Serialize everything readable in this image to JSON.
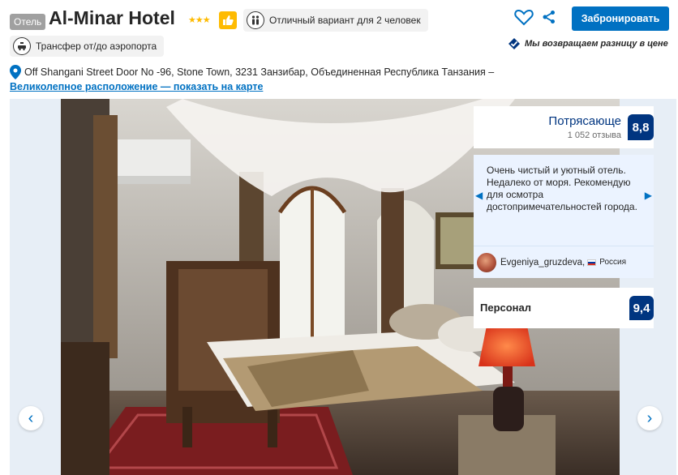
{
  "header": {
    "type_badge": "Отель",
    "hotel_name": "Al-Minar Hotel",
    "stars": "★★★",
    "star_rating": 3,
    "couple_label": "Отличный вариант для 2 человек",
    "transfer_label": "Трансфер от/до аэропорта",
    "book_label": "Забронировать",
    "price_match": "Мы возвращаем разницу в цене",
    "address": "Off Shangani Street Door No -96, Stone Town, 3231 Занзибар, Объединенная Республика Танзания –",
    "map_link": "Великолепное расположение — показать на карте"
  },
  "icons": {
    "thumb": "thumbs-up-icon",
    "heart": "heart-icon",
    "share": "share-icon",
    "pin": "map-pin-icon",
    "couple": "couple-icon",
    "transfer": "taxi-icon",
    "price_match": "checkmark-icon"
  },
  "gallery": {
    "prev": "‹",
    "next": "›"
  },
  "review": {
    "score_word": "Потрясающе",
    "review_count": "1 052 отзыва",
    "score": "8,8",
    "quote": "Очень чистый и уютный отель. Недалеко от моря. Рекомендую для осмотра достопримечательностей города.",
    "reviewer": "Evgeniya_gruzdeva,",
    "country": "Россия",
    "staff_label": "Персонал",
    "staff_score": "9,4",
    "arrow_left": "◀",
    "arrow_right": "▶"
  },
  "colors": {
    "accent": "#0071c2",
    "score_bg": "#003580",
    "star": "#febb02",
    "quote_bg": "#ebf3ff"
  }
}
